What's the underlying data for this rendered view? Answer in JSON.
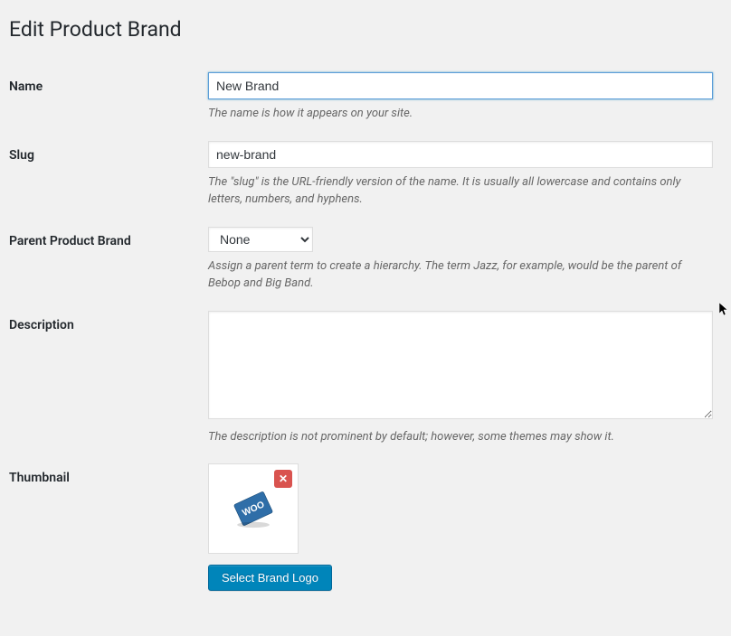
{
  "page": {
    "title": "Edit Product Brand"
  },
  "fields": {
    "name": {
      "label": "Name",
      "value": "New Brand",
      "description": "The name is how it appears on your site."
    },
    "slug": {
      "label": "Slug",
      "value": "new-brand",
      "description": "The \"slug\" is the URL-friendly version of the name. It is usually all lowercase and contains only letters, numbers, and hyphens."
    },
    "parent": {
      "label": "Parent Product Brand",
      "selected": "None",
      "description": "Assign a parent term to create a hierarchy. The term Jazz, for example, would be the parent of Bebop and Big Band."
    },
    "description": {
      "label": "Description",
      "value": "",
      "description": "The description is not prominent by default; however, some themes may show it."
    },
    "thumbnail": {
      "label": "Thumbnail",
      "remove_label": "✕",
      "button_label": "Select Brand Logo"
    }
  }
}
